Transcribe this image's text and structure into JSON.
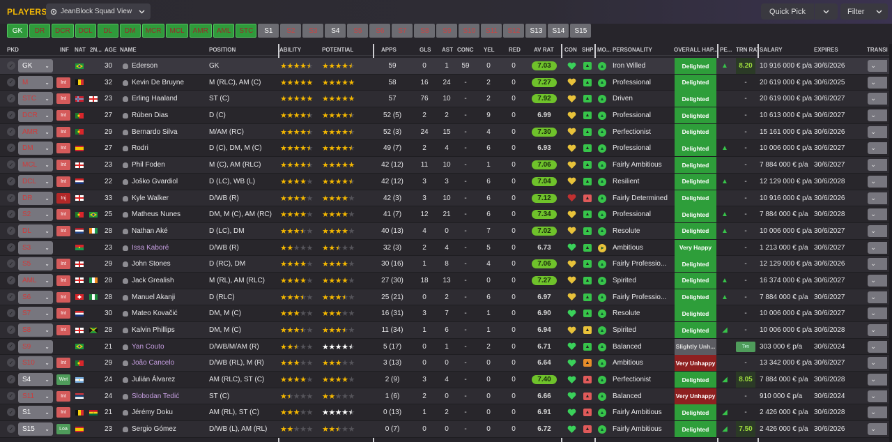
{
  "header": {
    "title": "PLAYERS",
    "view_label": "JeanBlock Squad View",
    "quick_pick": "Quick Pick",
    "filter": "Filter"
  },
  "position_tabs": [
    {
      "label": "GK",
      "style": "g sel"
    },
    {
      "label": "DR",
      "style": "g"
    },
    {
      "label": "DCR",
      "style": "g"
    },
    {
      "label": "DCL",
      "style": "g"
    },
    {
      "label": "DL",
      "style": "g"
    },
    {
      "label": "DM",
      "style": "g"
    },
    {
      "label": "MCR",
      "style": "g"
    },
    {
      "label": "MCL",
      "style": "g"
    },
    {
      "label": "AMR",
      "style": "g"
    },
    {
      "label": "AML",
      "style": "g"
    },
    {
      "label": "STC",
      "style": "g"
    },
    {
      "label": "S1",
      "style": "s"
    },
    {
      "label": "S2",
      "style": "r"
    },
    {
      "label": "S3",
      "style": "r"
    },
    {
      "label": "S4",
      "style": "s"
    },
    {
      "label": "S5",
      "style": "r"
    },
    {
      "label": "S6",
      "style": "r"
    },
    {
      "label": "S7",
      "style": "r"
    },
    {
      "label": "S8",
      "style": "r"
    },
    {
      "label": "S9",
      "style": "r"
    },
    {
      "label": "S10",
      "style": "r"
    },
    {
      "label": "S11",
      "style": "r"
    },
    {
      "label": "S12",
      "style": "r"
    },
    {
      "label": "S13",
      "style": "s"
    },
    {
      "label": "S14",
      "style": "s"
    },
    {
      "label": "S15",
      "style": "s"
    }
  ],
  "columns": {
    "pkd": "PKD",
    "inf": "INF",
    "nat": "NAT",
    "nat2": "2N...",
    "age": "AGE",
    "name": "NAME",
    "position": "POSITION",
    "ability": "ABILITY",
    "potential": "POTENTIAL",
    "apps": "APPS",
    "gls": "GLS",
    "ast": "AST",
    "conc": "CONC",
    "yel": "YEL",
    "red": "RED",
    "avrat": "AV RAT",
    "con": "CON",
    "shp": "SHP",
    "mor": "MO...",
    "personality": "PERSONALITY",
    "happiness": "OVERALL HAP...",
    "pe": "PE...",
    "trn": "TRN RAT",
    "salary": "SALARY",
    "expires": "EXPIRES",
    "transfer": "TRANSI"
  },
  "players": [
    {
      "sel": "GK",
      "inf": "",
      "nat": "BR",
      "nat2": "",
      "age": "30",
      "name": "Ederson",
      "pos": "GK",
      "ab": 4.5,
      "pot": 4.5,
      "apps": "59",
      "gls": "0",
      "ast": "1",
      "conc": "59",
      "yel": "0",
      "red": "0",
      "avr": "7.03",
      "con": "g",
      "shp": "g",
      "mor": "g",
      "pers": "Iron Willed",
      "hap": "Delighted",
      "pe": "▲",
      "trn": "8.20",
      "sal": "10 916 000 € p/a",
      "exp": "30/6/2026"
    },
    {
      "sel": "M",
      "inf": "Int",
      "nat": "BE",
      "nat2": "",
      "age": "32",
      "name": "Kevin De Bruyne",
      "pos": "M (RLC), AM (C)",
      "ab": 5,
      "pot": 5,
      "apps": "58",
      "gls": "16",
      "ast": "24",
      "conc": "-",
      "yel": "2",
      "red": "0",
      "avr": "7.27",
      "con": "y",
      "shp": "g",
      "mor": "g",
      "pers": "Professional",
      "hap": "Delighted",
      "pe": "",
      "trn": "-",
      "sal": "20 619 000 € p/a",
      "exp": "30/6/2025"
    },
    {
      "sel": "STC",
      "inf": "Int",
      "nat": "NO",
      "nat2": "EN",
      "age": "23",
      "name": "Erling Haaland",
      "pos": "ST (C)",
      "ab": 5,
      "pot": 5,
      "apps": "57",
      "gls": "76",
      "ast": "10",
      "conc": "-",
      "yel": "2",
      "red": "0",
      "avr": "7.92",
      "con": "y",
      "shp": "g",
      "mor": "g",
      "pers": "Driven",
      "hap": "Delighted",
      "pe": "",
      "trn": "-",
      "sal": "20 619 000 € p/a",
      "exp": "30/6/2027"
    },
    {
      "sel": "DCR",
      "inf": "Int",
      "nat": "PT",
      "nat2": "",
      "age": "27",
      "name": "Rúben Dias",
      "pos": "D (C)",
      "ab": 4.5,
      "pot": 4.5,
      "apps": "52 (5)",
      "gls": "2",
      "ast": "2",
      "conc": "-",
      "yel": "9",
      "red": "0",
      "avr": "6.99",
      "con": "y",
      "shp": "g",
      "mor": "g",
      "pers": "Professional",
      "hap": "Delighted",
      "pe": "",
      "trn": "-",
      "sal": "10 613 000 € p/a",
      "exp": "30/6/2027"
    },
    {
      "sel": "AMR",
      "inf": "Int",
      "nat": "PT",
      "nat2": "",
      "age": "29",
      "name": "Bernardo Silva",
      "pos": "M/AM (RC)",
      "ab": 4.5,
      "pot": 4.5,
      "apps": "52 (3)",
      "gls": "24",
      "ast": "15",
      "conc": "-",
      "yel": "4",
      "red": "0",
      "avr": "7.30",
      "con": "y",
      "shp": "g",
      "mor": "g",
      "pers": "Perfectionist",
      "hap": "Delighted",
      "pe": "",
      "trn": "-",
      "sal": "15 161 000 € p/a",
      "exp": "30/6/2026"
    },
    {
      "sel": "DM",
      "inf": "Int",
      "nat": "ES",
      "nat2": "",
      "age": "27",
      "name": "Rodri",
      "pos": "D (C), DM, M (C)",
      "ab": 4.5,
      "pot": 4.5,
      "apps": "49 (7)",
      "gls": "2",
      "ast": "4",
      "conc": "-",
      "yel": "6",
      "red": "0",
      "avr": "6.93",
      "con": "y",
      "shp": "g",
      "mor": "g",
      "pers": "Professional",
      "hap": "Delighted",
      "pe": "▲",
      "trn": "-",
      "sal": "10 006 000 € p/a",
      "exp": "30/6/2027"
    },
    {
      "sel": "MCL",
      "inf": "Int",
      "nat": "EN",
      "nat2": "",
      "age": "23",
      "name": "Phil Foden",
      "pos": "M (C), AM (RLC)",
      "ab": 4.5,
      "pot": 5,
      "apps": "42 (12)",
      "gls": "11",
      "ast": "10",
      "conc": "-",
      "yel": "1",
      "red": "0",
      "avr": "7.06",
      "con": "y",
      "shp": "g",
      "mor": "g",
      "pers": "Fairly Ambitious",
      "hap": "Delighted",
      "pe": "",
      "trn": "-",
      "sal": "7 884 000 € p/a",
      "exp": "30/6/2027"
    },
    {
      "sel": "DCL",
      "inf": "Int",
      "nat": "HR",
      "nat2": "",
      "age": "22",
      "name": "Joško Gvardiol",
      "pos": "D (LC), WB (L)",
      "ab": 4,
      "pot": 4.5,
      "apps": "42 (12)",
      "gls": "3",
      "ast": "3",
      "conc": "-",
      "yel": "6",
      "red": "0",
      "avr": "7.04",
      "con": "y",
      "shp": "g",
      "mor": "g",
      "pers": "Resilient",
      "hap": "Delighted",
      "pe": "▲",
      "trn": "-",
      "sal": "12 129 000 € p/a",
      "exp": "30/6/2028"
    },
    {
      "sel": "DR",
      "inf": "Inj",
      "nat": "EN",
      "nat2": "",
      "age": "33",
      "name": "Kyle Walker",
      "pos": "D/WB (R)",
      "ab": 4,
      "pot": 4,
      "apps": "42 (3)",
      "gls": "3",
      "ast": "10",
      "conc": "-",
      "yel": "6",
      "red": "0",
      "avr": "7.12",
      "con": "r",
      "shp": "r",
      "mor": "g",
      "pers": "Fairly Determined",
      "hap": "Delighted",
      "pe": "",
      "trn": "-",
      "sal": "10 916 000 € p/a",
      "exp": "30/6/2026"
    },
    {
      "sel": "S2",
      "inf": "Int",
      "nat": "PT",
      "nat2": "BR",
      "age": "25",
      "name": "Matheus Nunes",
      "pos": "DM, M (C), AM (RC)",
      "ab": 4,
      "pot": 4,
      "apps": "41 (7)",
      "gls": "12",
      "ast": "21",
      "conc": "-",
      "yel": "6",
      "red": "0",
      "avr": "7.34",
      "con": "y",
      "shp": "g",
      "mor": "g",
      "pers": "Professional",
      "hap": "Delighted",
      "pe": "▲",
      "trn": "-",
      "sal": "7 884 000 € p/a",
      "exp": "30/6/2028"
    },
    {
      "sel": "DL",
      "inf": "Int",
      "nat": "NL",
      "nat2": "CI",
      "age": "28",
      "name": "Nathan Aké",
      "pos": "D (LC), DM",
      "ab": 3.5,
      "pot": 4,
      "apps": "40 (13)",
      "gls": "4",
      "ast": "0",
      "conc": "-",
      "yel": "7",
      "red": "0",
      "avr": "7.02",
      "con": "y",
      "shp": "g",
      "mor": "g",
      "pers": "Resolute",
      "hap": "Delighted",
      "pe": "▲",
      "trn": "-",
      "sal": "10 006 000 € p/a",
      "exp": "30/6/2027"
    },
    {
      "sel": "S3",
      "inf": "",
      "nat": "BF",
      "nat2": "",
      "age": "23",
      "name": "Issa Kaboré",
      "pos": "D/WB (R)",
      "ab": 2,
      "pot": 2.5,
      "apps": "32 (3)",
      "gls": "2",
      "ast": "4",
      "conc": "-",
      "yel": "5",
      "red": "0",
      "avr": "6.73",
      "con": "g",
      "shp": "g",
      "mor": "y",
      "pers": "Ambitious",
      "hap": "Very Happy",
      "pe": "",
      "trn": "-",
      "sal": "1 213 000 € p/a",
      "exp": "30/6/2027"
    },
    {
      "sel": "S5",
      "inf": "Int",
      "nat": "EN",
      "nat2": "",
      "age": "29",
      "name": "John Stones",
      "pos": "D (RC), DM",
      "ab": 4,
      "pot": 4,
      "apps": "30 (16)",
      "gls": "1",
      "ast": "8",
      "conc": "-",
      "yel": "4",
      "red": "0",
      "avr": "7.06",
      "con": "y",
      "shp": "g",
      "mor": "g",
      "pers": "Fairly Professio...",
      "hap": "Delighted",
      "pe": "",
      "trn": "-",
      "sal": "12 129 000 € p/a",
      "exp": "30/6/2026"
    },
    {
      "sel": "AML",
      "inf": "Int",
      "nat": "EN",
      "nat2": "IE",
      "age": "28",
      "name": "Jack Grealish",
      "pos": "M (RL), AM (RLC)",
      "ab": 4,
      "pot": 4,
      "apps": "27 (30)",
      "gls": "18",
      "ast": "13",
      "conc": "-",
      "yel": "0",
      "red": "0",
      "avr": "7.27",
      "con": "y",
      "shp": "g",
      "mor": "g",
      "pers": "Spirited",
      "hap": "Delighted",
      "pe": "▲",
      "trn": "-",
      "sal": "16 374 000 € p/a",
      "exp": "30/6/2027"
    },
    {
      "sel": "S6",
      "inf": "Int",
      "nat": "CH",
      "nat2": "NG",
      "age": "28",
      "name": "Manuel Akanji",
      "pos": "D (RLC)",
      "ab": 3.5,
      "pot": 3.5,
      "apps": "25 (21)",
      "gls": "0",
      "ast": "2",
      "conc": "-",
      "yel": "6",
      "red": "0",
      "avr": "6.97",
      "con": "y",
      "shp": "g",
      "mor": "g",
      "pers": "Fairly Professio...",
      "hap": "Delighted",
      "pe": "▲",
      "trn": "-",
      "sal": "7 884 000 € p/a",
      "exp": "30/6/2027"
    },
    {
      "sel": "S7",
      "inf": "Int",
      "nat": "HR",
      "nat2": "",
      "age": "30",
      "name": "Mateo Kovačić",
      "pos": "DM, M (C)",
      "ab": 3,
      "pot": 3,
      "apps": "16 (31)",
      "gls": "3",
      "ast": "7",
      "conc": "-",
      "yel": "1",
      "red": "0",
      "avr": "6.90",
      "con": "g",
      "shp": "g",
      "mor": "g",
      "pers": "Resolute",
      "hap": "Delighted",
      "pe": "",
      "trn": "-",
      "sal": "10 006 000 € p/a",
      "exp": "30/6/2027"
    },
    {
      "sel": "S8",
      "inf": "Int",
      "nat": "EN",
      "nat2": "JM",
      "age": "28",
      "name": "Kalvin Phillips",
      "pos": "DM, M (C)",
      "ab": 3.5,
      "pot": 3.5,
      "apps": "11 (34)",
      "gls": "1",
      "ast": "6",
      "conc": "-",
      "yel": "1",
      "red": "0",
      "avr": "6.94",
      "con": "y",
      "shp": "y",
      "mor": "g",
      "pers": "Spirited",
      "hap": "Delighted",
      "pe": "◢",
      "trn": "-",
      "sal": "10 006 000 € p/a",
      "exp": "30/6/2028"
    },
    {
      "sel": "S9",
      "inf": "Trn",
      "nat": "BR",
      "nat2": "",
      "age": "21",
      "name": "Yan Couto",
      "pos": "D/WB/M/AM (R)",
      "ab": 2.5,
      "pot": 4.5,
      "apps": "5 (17)",
      "gls": "0",
      "ast": "1",
      "conc": "-",
      "yel": "2",
      "red": "0",
      "avr": "6.71",
      "con": "g",
      "shp": "g",
      "mor": "g",
      "pers": "Balanced",
      "hap": "Slightly Unh...",
      "pe": "",
      "trn": "-",
      "sal": "303 000 € p/a",
      "exp": "30/6/2024"
    },
    {
      "sel": "S10",
      "inf": "Int",
      "nat": "PT",
      "nat2": "",
      "age": "29",
      "name": "João Cancelo",
      "pos": "D/WB (RL), M (R)",
      "ab": 3,
      "pot": 3,
      "apps": "3 (13)",
      "gls": "0",
      "ast": "0",
      "conc": "-",
      "yel": "0",
      "red": "0",
      "avr": "6.64",
      "con": "g",
      "shp": "o",
      "mor": "g",
      "pers": "Ambitious",
      "hap": "Very Unhappy",
      "pe": "",
      "trn": "-",
      "sal": "13 342 000 € p/a",
      "exp": "30/6/2027"
    },
    {
      "sel": "S4",
      "inf": "Wnt",
      "nat": "AR",
      "nat2": "",
      "age": "24",
      "name": "Julián Álvarez",
      "pos": "AM (RLC), ST (C)",
      "ab": 4,
      "pot": 4,
      "apps": "2 (9)",
      "gls": "3",
      "ast": "4",
      "conc": "-",
      "yel": "0",
      "red": "0",
      "avr": "7.40",
      "con": "g",
      "shp": "r",
      "mor": "g",
      "pers": "Perfectionist",
      "hap": "Delighted",
      "pe": "◢",
      "trn": "8.05",
      "sal": "7 884 000 € p/a",
      "exp": "30/6/2028"
    },
    {
      "sel": "S11",
      "inf": "Int",
      "nat": "RS",
      "nat2": "",
      "age": "24",
      "name": "Slobodan Tedić",
      "pos": "ST (C)",
      "ab": 1.5,
      "pot": 2,
      "apps": "1 (6)",
      "gls": "2",
      "ast": "0",
      "conc": "-",
      "yel": "0",
      "red": "0",
      "avr": "6.66",
      "con": "g",
      "shp": "r",
      "mor": "g",
      "pers": "Balanced",
      "hap": "Very Unhappy",
      "pe": "",
      "trn": "-",
      "sal": "910 000 € p/a",
      "exp": "30/6/2024"
    },
    {
      "sel": "S1",
      "inf": "Int",
      "nat": "BE",
      "nat2": "GH",
      "age": "21",
      "name": "Jérémy Doku",
      "pos": "AM (RL), ST (C)",
      "ab": 3,
      "pot": 4.5,
      "apps": "0 (13)",
      "gls": "1",
      "ast": "2",
      "conc": "-",
      "yel": "0",
      "red": "0",
      "avr": "6.91",
      "con": "g",
      "shp": "r",
      "mor": "g",
      "pers": "Fairly Ambitious",
      "hap": "Delighted",
      "pe": "◢",
      "trn": "-",
      "sal": "2 426 000 € p/a",
      "exp": "30/6/2028"
    },
    {
      "sel": "S15",
      "inf": "Loa",
      "nat": "ES",
      "nat2": "",
      "age": "23",
      "name": "Sergio Gómez",
      "pos": "D/WB (L), AM (RL)",
      "ab": 2,
      "pot": 2.5,
      "apps": "0 (7)",
      "gls": "0",
      "ast": "0",
      "conc": "-",
      "yel": "0",
      "red": "0",
      "avr": "6.72",
      "con": "g",
      "shp": "r",
      "mor": "g",
      "pers": "Fairly Ambitious",
      "hap": "Delighted",
      "pe": "◢",
      "trn": "7.50",
      "sal": "2 426 000 € p/a",
      "exp": "30/6/2026"
    }
  ],
  "colors": {
    "accent": "#f2b705",
    "green": "#2e9e3a",
    "red": "#8e2020"
  }
}
